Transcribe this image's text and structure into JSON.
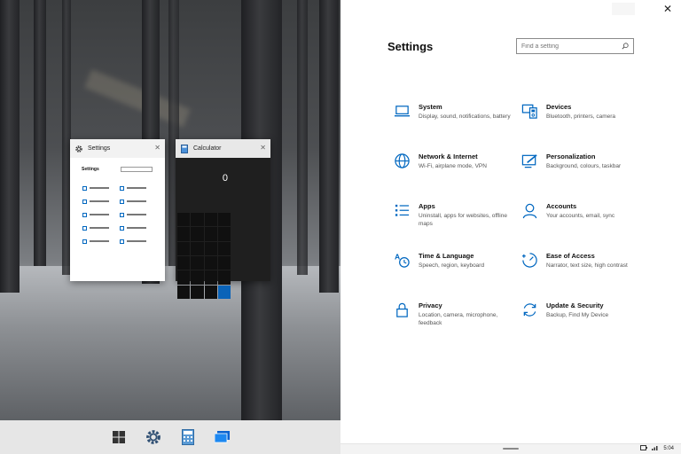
{
  "windows": {
    "settings_thumb": {
      "title": "Settings",
      "mini_title": "Settings"
    },
    "calculator_thumb": {
      "title": "Calculator",
      "display": "0"
    }
  },
  "taskbar": {
    "items": [
      {
        "name": "windows-start-icon"
      },
      {
        "name": "settings-gear-icon"
      },
      {
        "name": "calculator-icon"
      },
      {
        "name": "task-view-icon"
      }
    ]
  },
  "settings": {
    "title": "Settings",
    "search_placeholder": "Find a setting",
    "accent": "#0067c0",
    "categories": [
      {
        "title": "System",
        "desc": "Display, sound, notifications, battery",
        "icon": "laptop-icon"
      },
      {
        "title": "Devices",
        "desc": "Bluetooth, printers, camera",
        "icon": "devices-icon"
      },
      {
        "title": "Network & Internet",
        "desc": "Wi-Fi, airplane mode, VPN",
        "icon": "globe-icon"
      },
      {
        "title": "Personalization",
        "desc": "Background, colours, taskbar",
        "icon": "paint-icon"
      },
      {
        "title": "Apps",
        "desc": "Uninstall, apps for websites, offline maps",
        "icon": "apps-list-icon"
      },
      {
        "title": "Accounts",
        "desc": "Your accounts, email, sync",
        "icon": "person-icon"
      },
      {
        "title": "Time & Language",
        "desc": "Speech, region, keyboard",
        "icon": "time-language-icon"
      },
      {
        "title": "Ease of Access",
        "desc": "Narrator, text size, high contrast",
        "icon": "ease-of-access-icon"
      },
      {
        "title": "Privacy",
        "desc": "Location, camera, microphone, feedback",
        "icon": "lock-icon"
      },
      {
        "title": "Update & Security",
        "desc": "Backup, Find My Device",
        "icon": "sync-icon"
      }
    ]
  },
  "tray": {
    "time": "5:04"
  }
}
